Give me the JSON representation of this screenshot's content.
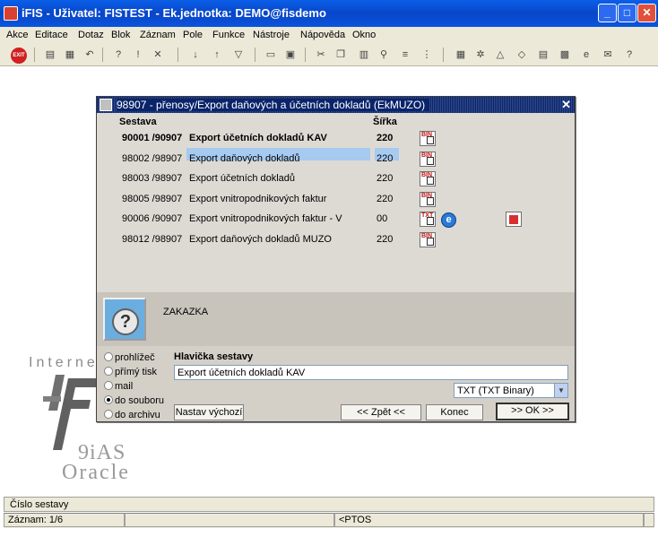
{
  "window": {
    "title": "iFIS - Uživatel: FISTEST - Ek.jednotka: DEMO@fisdemo",
    "minimize": "_",
    "maximize": "□",
    "close": "✕"
  },
  "menu": [
    "Akce",
    "Editace",
    "Dotaz",
    "Blok",
    "Záznam",
    "Pole",
    "Funkce",
    "Nástroje",
    "Nápověda",
    "Okno"
  ],
  "toolbar": {
    "exit": "EXIT"
  },
  "logo": {
    "line1": "Interne",
    "line2": "9iAS",
    "line3": "Oracle"
  },
  "dialog": {
    "title": "98907 - přenosy/Export daňových a účetních dokladů (EkMUZO)",
    "close": "✕",
    "col_sestava": "Sestava",
    "col_sirka": "Šířka",
    "rows": [
      {
        "code": "90001 /90907",
        "name": "Export účetních dokladů KAV",
        "width": "220",
        "icon": "BIN"
      },
      {
        "code": "98002 /98907",
        "name": "Export daňových dokladů",
        "width": "220",
        "icon": "BIN"
      },
      {
        "code": "98003 /98907",
        "name": "Export účetních dokladů",
        "width": "220",
        "icon": "BIN"
      },
      {
        "code": "98005 /98907",
        "name": "Export vnitropodnikových faktur",
        "width": "220",
        "icon": "BIN"
      },
      {
        "code": "90006 /90907",
        "name": "Export vnitropodnikových faktur - V",
        "width": "00",
        "icon": "TXT"
      },
      {
        "code": "98012 /98907",
        "name": "Export daňových dokladů MUZO",
        "width": "220",
        "icon": "BIN"
      }
    ],
    "zakazka": "ZAKAZKA",
    "radios": [
      {
        "label": "prohlížeč",
        "checked": false
      },
      {
        "label": "přímý tisk",
        "checked": false
      },
      {
        "label": "mail",
        "checked": false
      },
      {
        "label": "do souboru",
        "checked": true
      },
      {
        "label": "do archivu",
        "checked": false
      }
    ],
    "header_label": "Hlavička sestavy",
    "header_value": "Export účetních dokladů KAV",
    "format_value": "TXT (TXT Binary)",
    "btn_default": "Nastav výchozí",
    "btn_back": "<< Zpět <<",
    "btn_end": "Konec",
    "btn_ok": ">> OK >>"
  },
  "status": {
    "line1": "Číslo sestavy",
    "record": "Záznam: 1/6",
    "mode": "<PTOS"
  }
}
